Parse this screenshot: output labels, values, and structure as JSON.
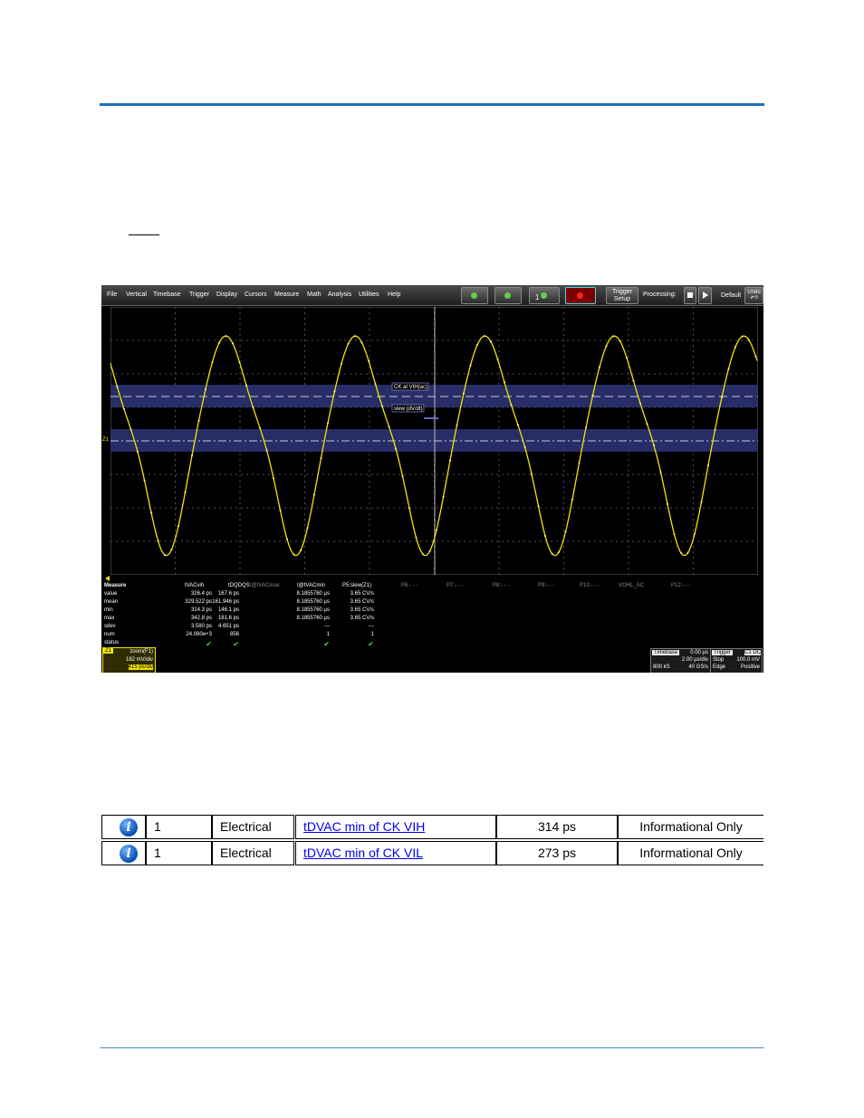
{
  "scope": {
    "menu": [
      "File",
      "Vertical",
      "Timebase",
      "Trigger",
      "Display",
      "Cursors",
      "Measure",
      "Math",
      "Analysis",
      "Utilities",
      "Help"
    ],
    "toolbar": {
      "trigger_setup_line1": "Trigger",
      "trigger_setup_line2": "Setup",
      "processing": "Processing:",
      "default": "Default",
      "undo_line1": "Undo",
      "undo_line2": "↶?",
      "channel_one": "1"
    },
    "annotations": {
      "upper_label": "CK at VIH(ac)",
      "lower_label": "slew (dV/dt)",
      "marker_z1": "Z1"
    },
    "measure": {
      "header": [
        "Measure",
        "tVACvih",
        "tDQDQS",
        "t@tVACmax",
        "t@tVACmin",
        "P5:slew(Z1)",
        "P6:- - -",
        "P7:- - -",
        "P8:- - -",
        "P9:- - -",
        "P10:- - -",
        "VOHL_AC",
        "P12:- - -"
      ],
      "rows": [
        {
          "label": "value",
          "c1": "326.4 ps",
          "c2": "167.6 ps",
          "c3": "",
          "c4": "8.1855760 µs",
          "c5": "3.65 CV/s"
        },
        {
          "label": "mean",
          "c1": "329.522 ps",
          "c2": "161.946 ps",
          "c3": "",
          "c4": "8.1855760 µs",
          "c5": "3.65 CV/s"
        },
        {
          "label": "min",
          "c1": "314.3 ps",
          "c2": "146.1 ps",
          "c3": "",
          "c4": "8.1855760 µs",
          "c5": "3.65 CV/s"
        },
        {
          "label": "max",
          "c1": "342.8 ps",
          "c2": "181.6 ps",
          "c3": "",
          "c4": "8.1855760 µs",
          "c5": "3.65 CV/s"
        },
        {
          "label": "sdev",
          "c1": "3.580 ps",
          "c2": "4.651 ps",
          "c3": "",
          "c4": "---",
          "c5": "---"
        },
        {
          "label": "num",
          "c1": "24.080e+3",
          "c2": "856",
          "c3": "",
          "c4": "1",
          "c5": "1"
        },
        {
          "label": "status",
          "c1": "✔",
          "c2": "✔",
          "c3": "",
          "c4": "✔",
          "c5": "✔"
        }
      ]
    },
    "zoom_badge": {
      "tag": "Z1",
      "title": "zoom(F1)",
      "line1": "182 mV/div",
      "line2": "415 ps/div"
    },
    "timebase_panel": {
      "title": "Timebase",
      "offset": "0.00 µs",
      "row2": "2.00 µs/div",
      "row3_left": "800 kS",
      "row3_right": "40 GS/s"
    },
    "trigger_panel": {
      "title": "Trigger",
      "channel": "C1 DC",
      "row2_left": "Stop",
      "row2_right": "100.0 mV",
      "row3_left": "Edge",
      "row3_right": "Positive"
    },
    "colors": {
      "trace": "#f2e400",
      "band": "#2a2f6e",
      "grid": "#555555"
    }
  },
  "results": [
    {
      "icon": "info-icon",
      "num": "1",
      "category": "Electrical",
      "test": "tDVAC min of CK VIH",
      "value": "314 ps",
      "status": "Informational Only"
    },
    {
      "icon": "info-icon",
      "num": "1",
      "category": "Electrical",
      "test": "tDVAC min of CK VIL",
      "value": "273 ps",
      "status": "Informational Only"
    }
  ]
}
